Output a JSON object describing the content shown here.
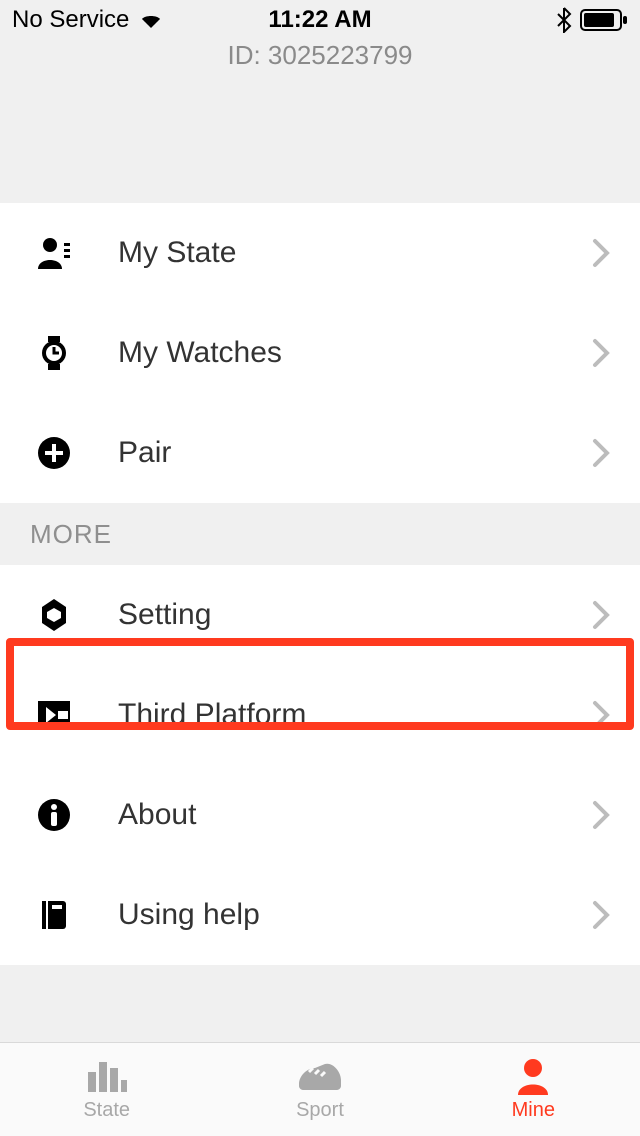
{
  "status": {
    "carrier": "No Service",
    "time": "11:22 AM"
  },
  "header": {
    "id_line": "ID: 3025223799"
  },
  "rows": {
    "my_state": "My State",
    "my_watches": "My Watches",
    "pair": "Pair",
    "setting": "Setting",
    "third_platform": "Third Platform",
    "about": "About",
    "using_help": "Using help"
  },
  "sections": {
    "more": "MORE"
  },
  "tabs": {
    "state": "State",
    "sport": "Sport",
    "mine": "Mine"
  }
}
